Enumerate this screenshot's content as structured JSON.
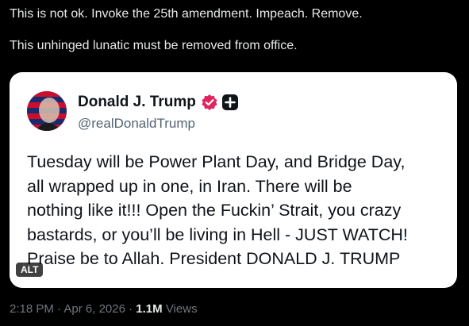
{
  "tweet": {
    "text_lines": [
      "This is not ok. Invoke the 25th amendment. Impeach. Remove.",
      "This unhinged lunatic must be removed from office."
    ]
  },
  "embedded_post": {
    "author_name": "Donald J. Trump",
    "author_handle": "@realDonaldTrump",
    "verified_icon": "verified-check-icon",
    "badge_icon": "plus-badge-icon",
    "body_lines": [
      "Tuesday will be Power Plant Day, and Bridge Day,",
      "all wrapped up in one, in Iran. There will be",
      "nothing like it!!! Open the Fuckin’ Strait, you crazy",
      "bastards, or you’ll be living in Hell - JUST WATCH!",
      "Praise be to Allah. President DONALD J. TRUMP"
    ],
    "alt_label": "ALT"
  },
  "meta": {
    "time": "2:18 PM",
    "separator": "·",
    "date": "Apr 6, 2026",
    "views_count": "1.1M",
    "views_label": "Views"
  },
  "colors": {
    "background": "#000000",
    "text": "#e7e9ea",
    "muted": "#71767b",
    "card": "#ffffff",
    "card_text": "#0f1419",
    "verified": "#e0245e"
  }
}
